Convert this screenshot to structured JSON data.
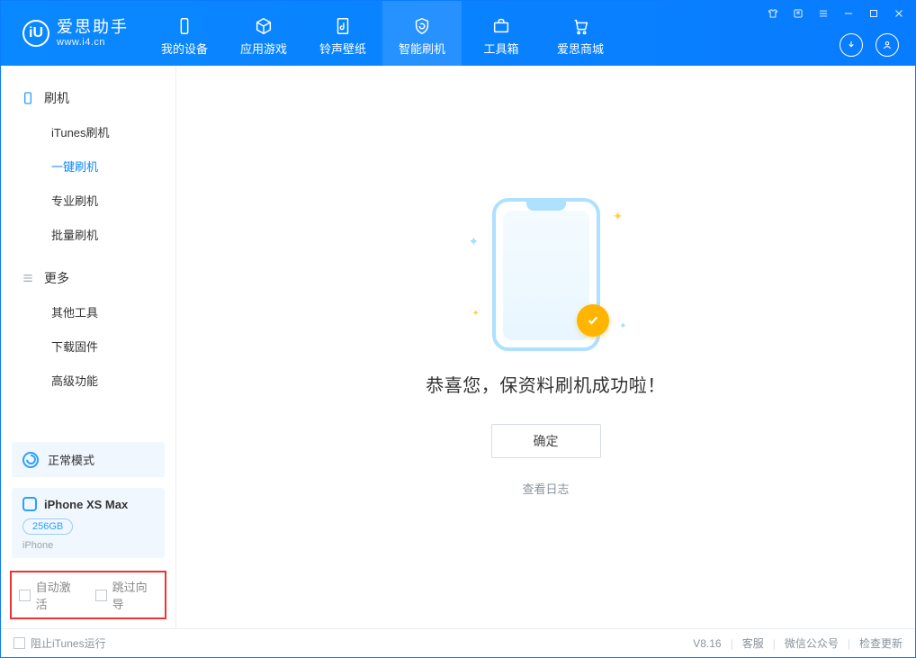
{
  "logo": {
    "name": "爱思助手",
    "url": "www.i4.cn",
    "mark": "iU"
  },
  "tabs": [
    {
      "label": "我的设备",
      "icon": "device"
    },
    {
      "label": "应用游戏",
      "icon": "cube"
    },
    {
      "label": "铃声壁纸",
      "icon": "music"
    },
    {
      "label": "智能刷机",
      "icon": "refresh",
      "active": true
    },
    {
      "label": "工具箱",
      "icon": "briefcase"
    },
    {
      "label": "爱思商城",
      "icon": "cart"
    }
  ],
  "titleControls": {
    "tshirt": "tshirt-icon",
    "book": "book-icon",
    "menu": "menu-icon",
    "minimize": "minimize-icon",
    "maximize": "maximize-icon",
    "close": "close-icon"
  },
  "sidebar": {
    "group1": {
      "label": "刷机",
      "items": [
        "iTunes刷机",
        "一键刷机",
        "专业刷机",
        "批量刷机"
      ],
      "activeIndex": 1
    },
    "group2": {
      "label": "更多",
      "items": [
        "其他工具",
        "下载固件",
        "高级功能"
      ]
    }
  },
  "mode": {
    "label": "正常模式"
  },
  "device": {
    "name": "iPhone XS Max",
    "capacity": "256GB",
    "type": "iPhone"
  },
  "options": {
    "auto_activate": "自动激活",
    "skip_guide": "跳过向导"
  },
  "main": {
    "success_text": "恭喜您，保资料刷机成功啦！",
    "ok_label": "确定",
    "log_link": "查看日志"
  },
  "status": {
    "block_itunes": "阻止iTunes运行",
    "version": "V8.16",
    "links": [
      "客服",
      "微信公众号",
      "检查更新"
    ]
  }
}
